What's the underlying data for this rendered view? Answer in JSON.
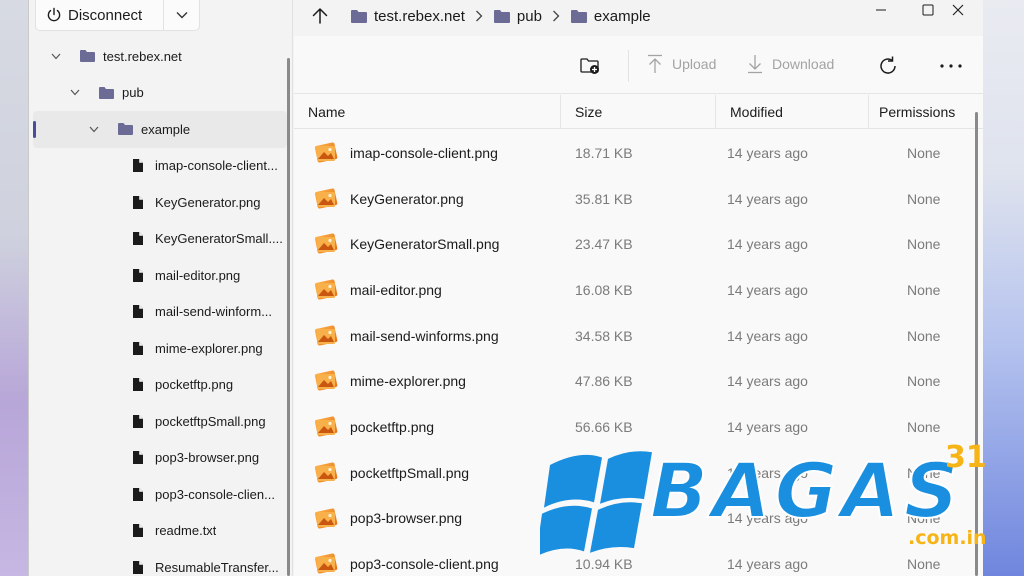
{
  "connection": {
    "disconnect_label": "Disconnect"
  },
  "tree": {
    "items": [
      {
        "label": "test.rebex.net",
        "type": "folder",
        "level": 0,
        "expanded": true
      },
      {
        "label": "pub",
        "type": "folder",
        "level": 1,
        "expanded": true
      },
      {
        "label": "example",
        "type": "folder",
        "level": 2,
        "expanded": true,
        "selected": true
      },
      {
        "label": "imap-console-client...",
        "type": "file",
        "level": 3
      },
      {
        "label": "KeyGenerator.png",
        "type": "file",
        "level": 3
      },
      {
        "label": "KeyGeneratorSmall....",
        "type": "file",
        "level": 3
      },
      {
        "label": "mail-editor.png",
        "type": "file",
        "level": 3
      },
      {
        "label": "mail-send-winform...",
        "type": "file",
        "level": 3
      },
      {
        "label": "mime-explorer.png",
        "type": "file",
        "level": 3
      },
      {
        "label": "pocketftp.png",
        "type": "file",
        "level": 3
      },
      {
        "label": "pocketftpSmall.png",
        "type": "file",
        "level": 3
      },
      {
        "label": "pop3-browser.png",
        "type": "file",
        "level": 3
      },
      {
        "label": "pop3-console-clien...",
        "type": "file",
        "level": 3
      },
      {
        "label": "readme.txt",
        "type": "file",
        "level": 3
      },
      {
        "label": "ResumableTransfer...",
        "type": "file",
        "level": 3
      }
    ]
  },
  "breadcrumb": [
    "test.rebex.net",
    "pub",
    "example"
  ],
  "toolbar": {
    "new_folder_icon": "new-folder-icon",
    "upload_label": "Upload",
    "download_label": "Download",
    "refresh_icon": "refresh-icon",
    "more_icon": "more-icon"
  },
  "table": {
    "headers": {
      "name": "Name",
      "size": "Size",
      "modified": "Modified",
      "permissions": "Permissions"
    },
    "rows": [
      {
        "name": "imap-console-client.png",
        "size": "18.71 KB",
        "modified": "14 years ago",
        "permissions": "None"
      },
      {
        "name": "KeyGenerator.png",
        "size": "35.81 KB",
        "modified": "14 years ago",
        "permissions": "None"
      },
      {
        "name": "KeyGeneratorSmall.png",
        "size": "23.47 KB",
        "modified": "14 years ago",
        "permissions": "None"
      },
      {
        "name": "mail-editor.png",
        "size": "16.08 KB",
        "modified": "14 years ago",
        "permissions": "None"
      },
      {
        "name": "mail-send-winforms.png",
        "size": "34.58 KB",
        "modified": "14 years ago",
        "permissions": "None"
      },
      {
        "name": "mime-explorer.png",
        "size": "47.86 KB",
        "modified": "14 years ago",
        "permissions": "None"
      },
      {
        "name": "pocketftp.png",
        "size": "56.66 KB",
        "modified": "14 years ago",
        "permissions": "None"
      },
      {
        "name": "pocketftpSmall.png",
        "size": "",
        "modified": "14 years ago",
        "permissions": "None"
      },
      {
        "name": "pop3-browser.png",
        "size": "",
        "modified": "14 years ago",
        "permissions": "None"
      },
      {
        "name": "pop3-console-client.png",
        "size": "10.94 KB",
        "modified": "14 years ago",
        "permissions": "None"
      }
    ]
  },
  "watermark": {
    "brand": "BAGAS",
    "superscript": "31",
    "domain": ".com.in"
  },
  "colors": {
    "folder": "#6b6b95",
    "accent_selection": "#4a4e9a",
    "watermark_blue": "#1a8fe0",
    "watermark_yellow": "#f7b416"
  }
}
